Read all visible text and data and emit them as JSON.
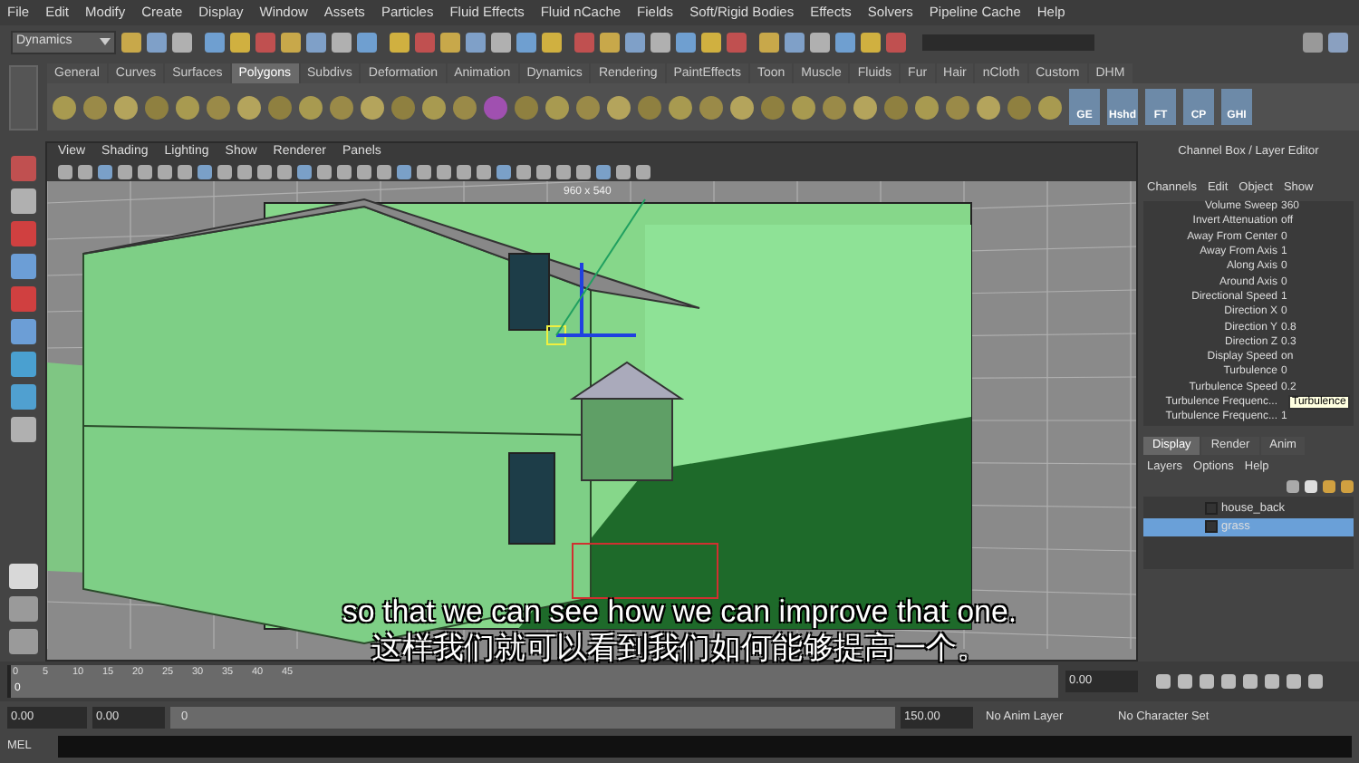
{
  "menu_bar": [
    "File",
    "Edit",
    "Modify",
    "Create",
    "Display",
    "Window",
    "Assets",
    "Particles",
    "Fluid Effects",
    "Fluid nCache",
    "Fields",
    "Soft/Rigid Bodies",
    "Effects",
    "Solvers",
    "Pipeline Cache",
    "Help"
  ],
  "menu_set": {
    "value": "Dynamics"
  },
  "shelf_tabs": [
    {
      "label": "General",
      "selected": false
    },
    {
      "label": "Curves",
      "selected": false
    },
    {
      "label": "Surfaces",
      "selected": false
    },
    {
      "label": "Polygons",
      "selected": true
    },
    {
      "label": "Subdivs",
      "selected": false
    },
    {
      "label": "Deformation",
      "selected": false
    },
    {
      "label": "Animation",
      "selected": false
    },
    {
      "label": "Dynamics",
      "selected": false
    },
    {
      "label": "Rendering",
      "selected": false
    },
    {
      "label": "PaintEffects",
      "selected": false
    },
    {
      "label": "Toon",
      "selected": false
    },
    {
      "label": "Muscle",
      "selected": false
    },
    {
      "label": "Fluids",
      "selected": false
    },
    {
      "label": "Fur",
      "selected": false
    },
    {
      "label": "Hair",
      "selected": false
    },
    {
      "label": "nCloth",
      "selected": false
    },
    {
      "label": "Custom",
      "selected": false
    },
    {
      "label": "DHM",
      "selected": false
    }
  ],
  "shelf_labeled_tools": [
    "GE",
    "Hshd",
    "FT",
    "CP",
    "GHI"
  ],
  "viewport": {
    "menus": [
      "View",
      "Shading",
      "Lighting",
      "Show",
      "Renderer",
      "Panels"
    ],
    "resolution": "960 x 540"
  },
  "channel_box": {
    "title": "Channel Box / Layer Editor",
    "menus": [
      "Channels",
      "Edit",
      "Object",
      "Show"
    ],
    "attributes": [
      {
        "name": "Volume Sweep",
        "value": "360"
      },
      {
        "name": "Invert Attenuation",
        "value": "off"
      },
      {
        "name": "Away From Center",
        "value": "0"
      },
      {
        "name": "Away From Axis",
        "value": "1"
      },
      {
        "name": "Along Axis",
        "value": "0"
      },
      {
        "name": "Around Axis",
        "value": "0"
      },
      {
        "name": "Directional Speed",
        "value": "1"
      },
      {
        "name": "Direction X",
        "value": "0"
      },
      {
        "name": "Direction Y",
        "value": "0.8"
      },
      {
        "name": "Direction Z",
        "value": "0.3"
      },
      {
        "name": "Display Speed",
        "value": "on"
      },
      {
        "name": "Turbulence",
        "value": "0"
      },
      {
        "name": "Turbulence Speed",
        "value": "0.2"
      },
      {
        "name": "Turbulence Frequenc..."
      },
      {
        "name": "Turbulence Frequenc...",
        "value": "1"
      }
    ],
    "tooltip": "Turbulence"
  },
  "layer_editor": {
    "tabs": [
      {
        "label": "Display",
        "selected": true
      },
      {
        "label": "Render",
        "selected": false
      },
      {
        "label": "Anim",
        "selected": false
      }
    ],
    "menus": [
      "Layers",
      "Options",
      "Help"
    ],
    "layers": [
      {
        "name": "house_back",
        "selected": false
      },
      {
        "name": "grass",
        "selected": true
      }
    ]
  },
  "time_slider": {
    "ticks": [
      "0",
      "5",
      "10",
      "15",
      "20",
      "25",
      "30",
      "35",
      "40",
      "45"
    ],
    "current_frame": "0",
    "current_time": "0.00",
    "level": 0
  },
  "range_slider": {
    "start": "0.00",
    "playback_start": "0.00",
    "range_label": "0",
    "level": 1,
    "end": "150.00",
    "anim_layer": "No Anim Layer",
    "character_set": "No Character Set"
  },
  "command_line": {
    "label": "MEL"
  },
  "subtitles": [
    "so that we can see how we can improve that one.",
    "这样我们就可以看到我们如何能够提高一个。"
  ]
}
